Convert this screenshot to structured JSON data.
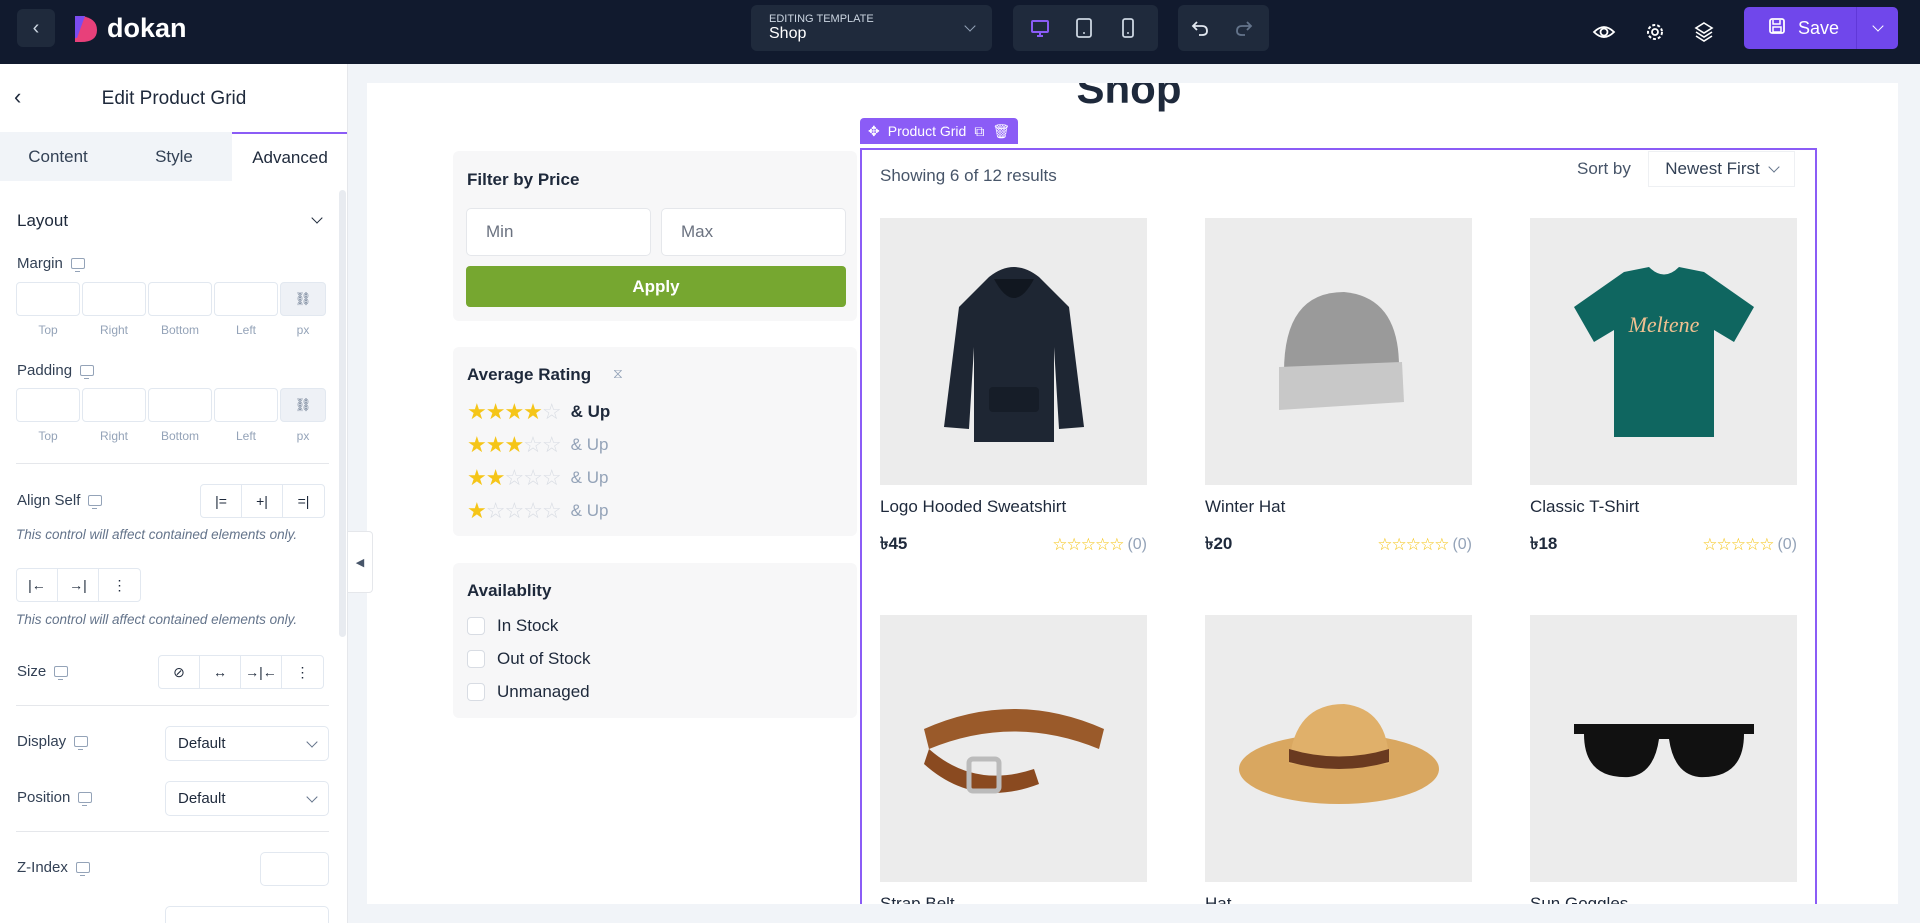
{
  "topbar": {
    "logo_text": "dokan",
    "template_caption": "EDITING TEMPLATE",
    "template_name": "Shop",
    "devices": [
      "desktop-icon",
      "tablet-icon",
      "mobile-icon"
    ],
    "active_device": "desktop",
    "save_label": "Save",
    "accent": "#7047eb"
  },
  "panel": {
    "title": "Edit Product Grid",
    "tabs": [
      {
        "label": "Content"
      },
      {
        "label": "Style"
      },
      {
        "label": "Advanced"
      }
    ],
    "active_tab": "Advanced",
    "section": "Layout",
    "margin": {
      "label": "Margin",
      "top": "",
      "right": "",
      "bottom": "",
      "left": "",
      "unit": "px"
    },
    "padding": {
      "label": "Padding",
      "top": "",
      "right": "",
      "bottom": "",
      "left": "",
      "unit": "px"
    },
    "side_labels": [
      "Top",
      "Right",
      "Bottom",
      "Left"
    ],
    "align_self": {
      "label": "Align Self"
    },
    "note": "This control will affect contained elements only.",
    "size": {
      "label": "Size"
    },
    "display": {
      "label": "Display",
      "value": "Default"
    },
    "position": {
      "label": "Position",
      "value": "Default"
    },
    "zindex": {
      "label": "Z-Index",
      "value": ""
    }
  },
  "canvas": {
    "page_title": "Shop",
    "widget_label": "Product Grid",
    "filter_price": {
      "title": "Filter by Price",
      "min_placeholder": "Min",
      "max_placeholder": "Max",
      "apply": "Apply",
      "apply_color": "#76a730"
    },
    "rating": {
      "title": "Average Rating",
      "rows": [
        {
          "stars": 4,
          "label": "& Up"
        },
        {
          "stars": 3,
          "label": "& Up"
        },
        {
          "stars": 2,
          "label": "& Up"
        },
        {
          "stars": 1,
          "label": "& Up"
        }
      ]
    },
    "availability": {
      "title": "Availablity",
      "options": [
        "In Stock",
        "Out of Stock",
        "Unmanaged"
      ]
    },
    "results": "Showing 6 of 12 results",
    "sort_label": "Sort by",
    "sort_value": "Newest First",
    "products": [
      {
        "name": "Logo Hooded Sweatshirt",
        "price": "৳45",
        "rating": 0,
        "reviews": "(0)",
        "image": "hoodie"
      },
      {
        "name": "Winter Hat",
        "price": "৳20",
        "rating": 0,
        "reviews": "(0)",
        "image": "beanie"
      },
      {
        "name": "Classic T-Shirt",
        "price": "৳18",
        "rating": 0,
        "reviews": "(0)",
        "image": "tshirt"
      },
      {
        "name": "Strap Belt",
        "image": "belt"
      },
      {
        "name": "Hat",
        "image": "sunhat"
      },
      {
        "name": "Sun Goggles",
        "image": "sunglasses"
      }
    ]
  }
}
